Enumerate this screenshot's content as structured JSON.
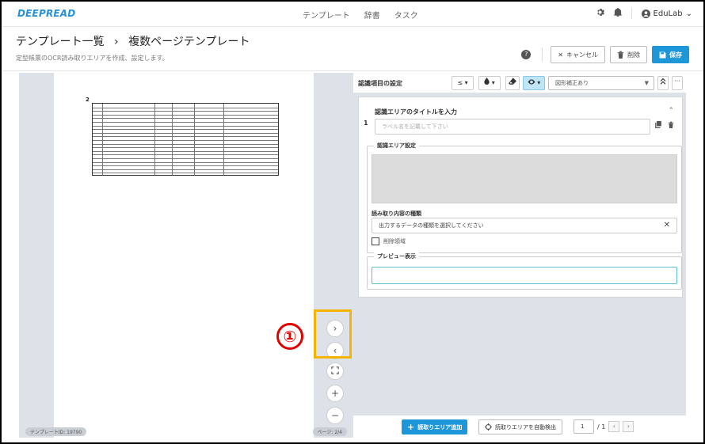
{
  "nav": {
    "brand": "DEEPREAD",
    "links": [
      "テンプレート",
      "辞書",
      "タスク"
    ],
    "user": "EduLab"
  },
  "header": {
    "breadcrumb_parent": "テンプレート一覧",
    "breadcrumb_sep": "›",
    "breadcrumb_current": "複数ページテンプレート",
    "subtitle": "定型帳票のOCR読み取りエリアを作成、設定します。",
    "cancel_label": "キャンセル",
    "delete_label": "削除",
    "save_label": "保存"
  },
  "left_pane": {
    "page_number": "2",
    "template_id": "テンプレートID: 19790",
    "page_indicator": "ページ: 2/4",
    "annotation_marker": "①"
  },
  "right_pane": {
    "section_title": "認識項目の設定",
    "image_correction": "図形補正あり",
    "item_index": "1",
    "area_title": "認識エリアのタイトルを入力",
    "label_placeholder": "ラベル名を記載して下さい",
    "recognition_area_legend": "認識エリア設定",
    "content_type_label": "読み取り内容の種類",
    "content_type_placeholder": "出力するデータの種類を選択してください",
    "delete_area_label": "削除領域",
    "preview_legend": "プレビュー表示"
  },
  "bottom": {
    "add_area_label": "読取りエリア追加",
    "auto_detect_label": "読取りエリアを自動検出",
    "page_value": "1",
    "page_total": "/ 1"
  },
  "colors": {
    "brand": "#2592d6",
    "primary_button": "#1e97d9",
    "highlight_box": "#f5b400",
    "annotation_red": "#e10000"
  }
}
